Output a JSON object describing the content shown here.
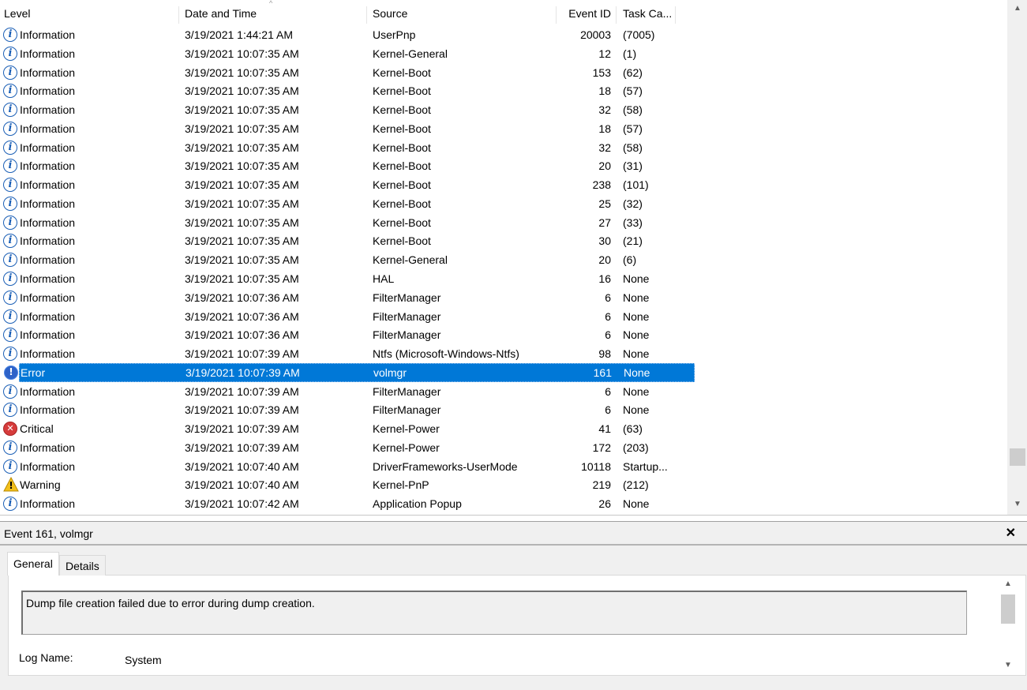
{
  "list": {
    "headers": {
      "level": "Level",
      "date": "Date and Time",
      "source": "Source",
      "event_id": "Event ID",
      "task": "Task Ca..."
    },
    "sort_indicator": "^",
    "rows": [
      {
        "level": "Information",
        "date": "3/19/2021 1:44:21 AM",
        "source": "UserPnp",
        "event_id": "20003",
        "task": "(7005)",
        "icon": "info-icon"
      },
      {
        "level": "Information",
        "date": "3/19/2021 10:07:35 AM",
        "source": "Kernel-General",
        "event_id": "12",
        "task": "(1)",
        "icon": "info-icon"
      },
      {
        "level": "Information",
        "date": "3/19/2021 10:07:35 AM",
        "source": "Kernel-Boot",
        "event_id": "153",
        "task": "(62)",
        "icon": "info-icon"
      },
      {
        "level": "Information",
        "date": "3/19/2021 10:07:35 AM",
        "source": "Kernel-Boot",
        "event_id": "18",
        "task": "(57)",
        "icon": "info-icon"
      },
      {
        "level": "Information",
        "date": "3/19/2021 10:07:35 AM",
        "source": "Kernel-Boot",
        "event_id": "32",
        "task": "(58)",
        "icon": "info-icon"
      },
      {
        "level": "Information",
        "date": "3/19/2021 10:07:35 AM",
        "source": "Kernel-Boot",
        "event_id": "18",
        "task": "(57)",
        "icon": "info-icon"
      },
      {
        "level": "Information",
        "date": "3/19/2021 10:07:35 AM",
        "source": "Kernel-Boot",
        "event_id": "32",
        "task": "(58)",
        "icon": "info-icon"
      },
      {
        "level": "Information",
        "date": "3/19/2021 10:07:35 AM",
        "source": "Kernel-Boot",
        "event_id": "20",
        "task": "(31)",
        "icon": "info-icon"
      },
      {
        "level": "Information",
        "date": "3/19/2021 10:07:35 AM",
        "source": "Kernel-Boot",
        "event_id": "238",
        "task": "(101)",
        "icon": "info-icon"
      },
      {
        "level": "Information",
        "date": "3/19/2021 10:07:35 AM",
        "source": "Kernel-Boot",
        "event_id": "25",
        "task": "(32)",
        "icon": "info-icon"
      },
      {
        "level": "Information",
        "date": "3/19/2021 10:07:35 AM",
        "source": "Kernel-Boot",
        "event_id": "27",
        "task": "(33)",
        "icon": "info-icon"
      },
      {
        "level": "Information",
        "date": "3/19/2021 10:07:35 AM",
        "source": "Kernel-Boot",
        "event_id": "30",
        "task": "(21)",
        "icon": "info-icon"
      },
      {
        "level": "Information",
        "date": "3/19/2021 10:07:35 AM",
        "source": "Kernel-General",
        "event_id": "20",
        "task": "(6)",
        "icon": "info-icon"
      },
      {
        "level": "Information",
        "date": "3/19/2021 10:07:35 AM",
        "source": "HAL",
        "event_id": "16",
        "task": "None",
        "icon": "info-icon"
      },
      {
        "level": "Information",
        "date": "3/19/2021 10:07:36 AM",
        "source": "FilterManager",
        "event_id": "6",
        "task": "None",
        "icon": "info-icon"
      },
      {
        "level": "Information",
        "date": "3/19/2021 10:07:36 AM",
        "source": "FilterManager",
        "event_id": "6",
        "task": "None",
        "icon": "info-icon"
      },
      {
        "level": "Information",
        "date": "3/19/2021 10:07:36 AM",
        "source": "FilterManager",
        "event_id": "6",
        "task": "None",
        "icon": "info-icon"
      },
      {
        "level": "Information",
        "date": "3/19/2021 10:07:39 AM",
        "source": "Ntfs (Microsoft-Windows-Ntfs)",
        "event_id": "98",
        "task": "None",
        "icon": "info-icon"
      },
      {
        "level": "Error",
        "date": "3/19/2021 10:07:39 AM",
        "source": "volmgr",
        "event_id": "161",
        "task": "None",
        "icon": "error-icon",
        "selected": true
      },
      {
        "level": "Information",
        "date": "3/19/2021 10:07:39 AM",
        "source": "FilterManager",
        "event_id": "6",
        "task": "None",
        "icon": "info-icon"
      },
      {
        "level": "Information",
        "date": "3/19/2021 10:07:39 AM",
        "source": "FilterManager",
        "event_id": "6",
        "task": "None",
        "icon": "info-icon"
      },
      {
        "level": "Critical",
        "date": "3/19/2021 10:07:39 AM",
        "source": "Kernel-Power",
        "event_id": "41",
        "task": "(63)",
        "icon": "critical-icon"
      },
      {
        "level": "Information",
        "date": "3/19/2021 10:07:39 AM",
        "source": "Kernel-Power",
        "event_id": "172",
        "task": "(203)",
        "icon": "info-icon"
      },
      {
        "level": "Information",
        "date": "3/19/2021 10:07:40 AM",
        "source": "DriverFrameworks-UserMode",
        "event_id": "10118",
        "task": "Startup...",
        "icon": "info-icon"
      },
      {
        "level": "Warning",
        "date": "3/19/2021 10:07:40 AM",
        "source": "Kernel-PnP",
        "event_id": "219",
        "task": "(212)",
        "icon": "warning-icon"
      },
      {
        "level": "Information",
        "date": "3/19/2021 10:07:42 AM",
        "source": "Application Popup",
        "event_id": "26",
        "task": "None",
        "icon": "info-icon"
      }
    ]
  },
  "detail": {
    "title": "Event 161, volmgr",
    "close_glyph": "✕",
    "tabs": [
      {
        "label": "General",
        "active": true
      },
      {
        "label": "Details",
        "active": false
      }
    ],
    "description": "Dump file creation failed due to error during dump creation.",
    "log_name_label": "Log Name:",
    "log_name_value": "System"
  },
  "colors": {
    "selection": "#0078d7",
    "info_icon": "#1b5fb6",
    "critical_icon": "#d63b3b",
    "warning_icon": "#f3c01b"
  }
}
